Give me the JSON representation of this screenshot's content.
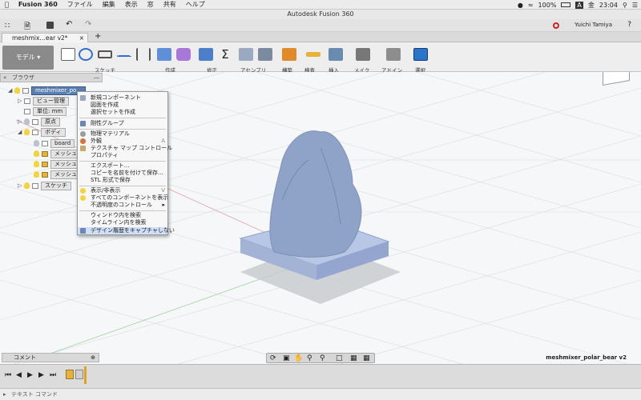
{
  "menubar": {
    "app": "Fusion 360",
    "items": [
      "ファイル",
      "編集",
      "表示",
      "窓",
      "共有",
      "ヘルプ"
    ],
    "battery": "100%",
    "day": "金",
    "time": "23:04",
    "input_indicator": "A"
  },
  "window": {
    "title": "Autodesk Fusion 360"
  },
  "toolbar": {
    "user": "Yuichi Tamiya"
  },
  "tabs": [
    {
      "label": "meshmix…ear v2*"
    }
  ],
  "ribbon": {
    "workspace": "モデル",
    "groups": [
      "スケッチ",
      "作成",
      "修正",
      "アセンブリ",
      "構築",
      "検査",
      "挿入",
      "メイク",
      "アドイン",
      "選択"
    ]
  },
  "browser": {
    "title": "ブラウザ",
    "root": "meshmixer_po…",
    "nodes": [
      "ビュー管理",
      "単位: mm",
      "原点",
      "ボディ",
      "board",
      "メッシュ",
      "メッシュ",
      "メッシュ",
      "スケッチ"
    ]
  },
  "context_menu": {
    "items": [
      "新規コンポーネント",
      "図面を作成",
      "選択セットを作成",
      "剛性グループ",
      "物理マテリアル",
      "外観",
      "テクスチャ マップ コントロール",
      "プロパティ",
      "エクスポート...",
      "コピーを名前を付けて保存...",
      "STL 形式で保存",
      "表示/非表示",
      "すべてのコンポーネントを表示",
      "不透明度のコントロール",
      "ウィンドウ内を検索",
      "タイムライン内を検索",
      "デザイン履歴をキャプチャしない"
    ],
    "shortcut_a": "A",
    "shortcut_v": "V"
  },
  "comment": {
    "label": "コメント"
  },
  "document_name": "meshmixer_polar_bear v2",
  "text_command": "テキスト コマンド",
  "colors": {
    "selection": "#0696d7",
    "mesh": "#8ea3c7",
    "base": "#b9c7e6",
    "grid": "#d5d8dc"
  }
}
